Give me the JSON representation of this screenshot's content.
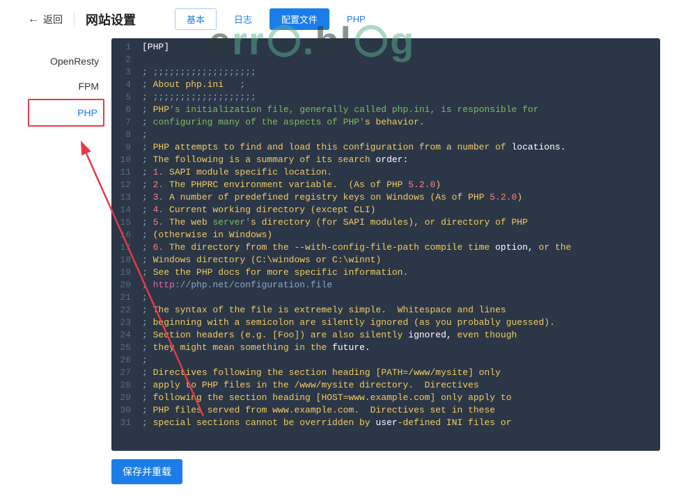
{
  "header": {
    "back_label": "返回",
    "title": "网站设置",
    "tabs": {
      "basic": "基本",
      "log": "日志",
      "config": "配置文件",
      "php": "PHP"
    }
  },
  "sidebar": {
    "items": [
      "OpenResty",
      "FPM",
      "PHP"
    ]
  },
  "footer": {
    "save_label": "保存并重载"
  },
  "code_lines": [
    [
      [
        "c-sec",
        "[PHP]"
      ]
    ],
    [],
    [
      [
        "c-cm",
        "; ;;;;;;;;;;;;;;;;;;;"
      ]
    ],
    [
      [
        "c-cm",
        "; "
      ],
      [
        "c-kw",
        "About php.ini   "
      ],
      [
        "c-cm",
        ";"
      ]
    ],
    [
      [
        "c-cm",
        "; ;;;;;;;;;;;;;;;;;;;"
      ]
    ],
    [
      [
        "c-cm",
        "; "
      ],
      [
        "c-kw",
        "PHP"
      ],
      [
        "c-str",
        "'s initialization file, generally called php.ini, is responsible for"
      ]
    ],
    [
      [
        "c-cm",
        "; "
      ],
      [
        "c-str",
        "configuring many of the aspects of PHP'"
      ],
      [
        "c-kw",
        "s behavior."
      ]
    ],
    [
      [
        "c-cm",
        ";"
      ]
    ],
    [
      [
        "c-cm",
        "; "
      ],
      [
        "c-kw",
        "PHP attempts to find and load this configuration from a number of "
      ],
      [
        "c-wh",
        "locations."
      ]
    ],
    [
      [
        "c-cm",
        "; "
      ],
      [
        "c-kw",
        "The following is a summary of its search "
      ],
      [
        "c-wh",
        "order:"
      ]
    ],
    [
      [
        "c-cm",
        "; "
      ],
      [
        "c-num",
        "1."
      ],
      [
        "c-kw",
        " SAPI module specific location."
      ]
    ],
    [
      [
        "c-cm",
        "; "
      ],
      [
        "c-num",
        "2."
      ],
      [
        "c-kw",
        " The PHPRC environment variable.  (As of PHP "
      ],
      [
        "c-num",
        "5.2.0"
      ],
      [
        "c-kw",
        ")"
      ]
    ],
    [
      [
        "c-cm",
        "; "
      ],
      [
        "c-num",
        "3."
      ],
      [
        "c-kw",
        " A number of predefined registry keys on Windows (As of PHP "
      ],
      [
        "c-num",
        "5.2.0"
      ],
      [
        "c-kw",
        ")"
      ]
    ],
    [
      [
        "c-cm",
        "; "
      ],
      [
        "c-num",
        "4."
      ],
      [
        "c-kw",
        " Current working directory (except CLI)"
      ]
    ],
    [
      [
        "c-cm",
        "; "
      ],
      [
        "c-num",
        "5."
      ],
      [
        "c-kw",
        " The web "
      ],
      [
        "c-str",
        "server'"
      ],
      [
        "c-kw",
        "s directory (for SAPI modules), or directory of PHP"
      ]
    ],
    [
      [
        "c-cm",
        "; "
      ],
      [
        "c-kw",
        "(otherwise in Windows)"
      ]
    ],
    [
      [
        "c-cm",
        "; "
      ],
      [
        "c-num",
        "6."
      ],
      [
        "c-kw",
        " The directory from the --with-config-file-path compile time "
      ],
      [
        "c-wh",
        "option, "
      ],
      [
        "c-kw",
        "or the"
      ]
    ],
    [
      [
        "c-cm",
        "; "
      ],
      [
        "c-kw",
        "Windows directory (C:\\windows or C:\\winnt)"
      ]
    ],
    [
      [
        "c-cm",
        "; "
      ],
      [
        "c-kw",
        "See the PHP docs for more specific information."
      ]
    ],
    [
      [
        "c-cm",
        "; "
      ],
      [
        "c-pk",
        "http:"
      ],
      [
        "c-cm",
        "//php.net/configuration.file"
      ]
    ],
    [
      [
        "c-cm",
        ";"
      ]
    ],
    [
      [
        "c-cm",
        "; "
      ],
      [
        "c-kw",
        "The syntax of the file is extremely simple.  Whitespace and lines"
      ]
    ],
    [
      [
        "c-cm",
        "; "
      ],
      [
        "c-kw",
        "beginning with a semicolon are silently ignored (as you probably guessed)."
      ]
    ],
    [
      [
        "c-cm",
        "; "
      ],
      [
        "c-kw",
        "Section headers (e.g. [Foo]) are also silently "
      ],
      [
        "c-wh",
        "ignored, "
      ],
      [
        "c-kw",
        "even though"
      ]
    ],
    [
      [
        "c-cm",
        "; "
      ],
      [
        "c-kw",
        "they might mean something in the "
      ],
      [
        "c-wh",
        "future."
      ]
    ],
    [
      [
        "c-cm",
        ";"
      ]
    ],
    [
      [
        "c-cm",
        "; "
      ],
      [
        "c-kw",
        "Directives following the section heading [PATH=/www/mysite] only"
      ]
    ],
    [
      [
        "c-cm",
        "; "
      ],
      [
        "c-kw",
        "apply to PHP files in the /www/mysite directory.  Directives"
      ]
    ],
    [
      [
        "c-cm",
        "; "
      ],
      [
        "c-kw",
        "following the section heading [HOST=www.example.com] only apply to"
      ]
    ],
    [
      [
        "c-cm",
        "; "
      ],
      [
        "c-kw",
        "PHP files served from www.example.com.  Directives set in these"
      ]
    ],
    [
      [
        "c-cm",
        "; "
      ],
      [
        "c-kw",
        "special sections cannot be overridden by "
      ],
      [
        "c-wh",
        "user"
      ],
      [
        "c-kw",
        "-defined INI files or"
      ]
    ]
  ]
}
